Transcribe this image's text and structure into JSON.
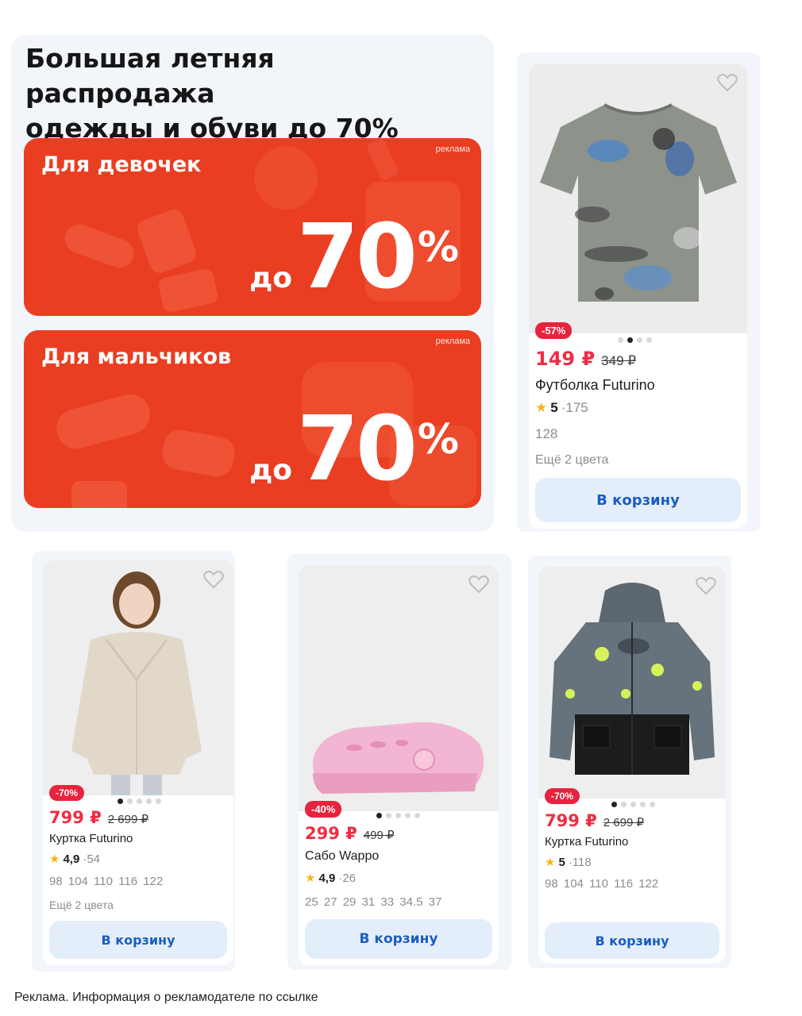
{
  "promo": {
    "title_line1": "Большая летняя распродажа",
    "title_line2": "одежды и обуви до 70%",
    "banners": [
      {
        "title": "Для девочек",
        "ad_label": "реклама",
        "prefix": "до",
        "percent": "70",
        "percent_sign": "%"
      },
      {
        "title": "Для мальчиков",
        "ad_label": "реклама",
        "prefix": "до",
        "percent": "70",
        "percent_sign": "%"
      }
    ]
  },
  "products": [
    {
      "badge": "-57%",
      "price": "149 ₽",
      "old_price": "349 ₽",
      "name": "Футболка Futurino",
      "rating": "5",
      "reviews": "175",
      "sizes": "128",
      "colors": "Ещё 2 цвета",
      "cart": "В корзину",
      "icon": "heart-icon"
    },
    {
      "badge": "-70%",
      "price": "799 ₽",
      "old_price": "2 699 ₽",
      "name": "Куртка Futurino",
      "rating": "4,9",
      "reviews": "54",
      "sizes": "98 104 110 116 122",
      "colors": "Ещё 2 цвета",
      "cart": "В корзину",
      "icon": "heart-icon"
    },
    {
      "badge": "-40%",
      "price": "299 ₽",
      "old_price": "499 ₽",
      "name": "Сабо Wappo",
      "rating": "4,9",
      "reviews": "26",
      "sizes": "25 27 29 31 33 34.5 37",
      "cart": "В корзину",
      "icon": "heart-icon"
    },
    {
      "badge": "-70%",
      "price": "799 ₽",
      "old_price": "2 699 ₽",
      "name": "Куртка Futurino",
      "rating": "5",
      "reviews": "118",
      "sizes": "98 104 110 116 122",
      "cart": "В корзину",
      "icon": "heart-icon"
    }
  ],
  "rating_separator": "·",
  "footer": "Реклама. Информация о рекламодателе по ссылке",
  "colors": {
    "banner": "#ea3e22",
    "badge": "#e8233d",
    "price": "#ee2d45",
    "cart_bg": "#e4eefa",
    "cart_text": "#1a5dc2",
    "panel": "#f2f5fa"
  }
}
